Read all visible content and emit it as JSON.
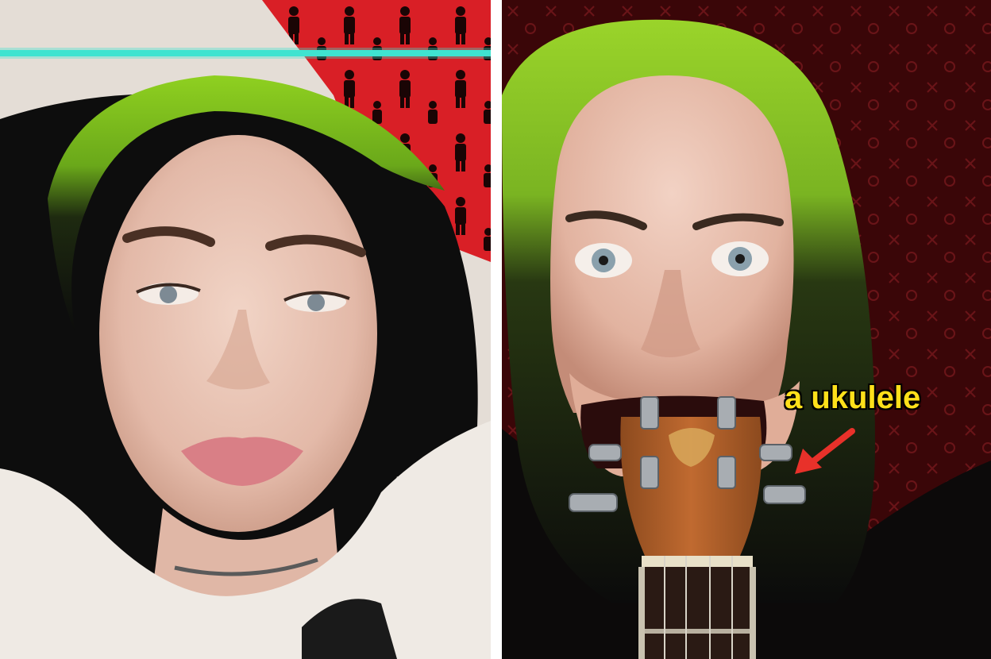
{
  "annotation": {
    "text": "a ukulele",
    "text_color": "#ffe01a",
    "arrow_color": "#e8312a"
  },
  "left_panel": {
    "filter_line_color": "#3fe3d0",
    "pillow_color": "#d91f26",
    "pillow_pattern_icon": "person-silhouette-icon",
    "hair_root_color": "#8fd020",
    "hair_end_color": "#0c0c0c",
    "shirt_color": "#efeae4"
  },
  "right_panel": {
    "background_color": "#3a0608",
    "background_pattern_icon": "monogram-pattern-icon",
    "hair_root_color": "#9ad42a",
    "ukulele_color": "#b4622a",
    "headstock_logo_icon": "lion-logo-icon"
  }
}
